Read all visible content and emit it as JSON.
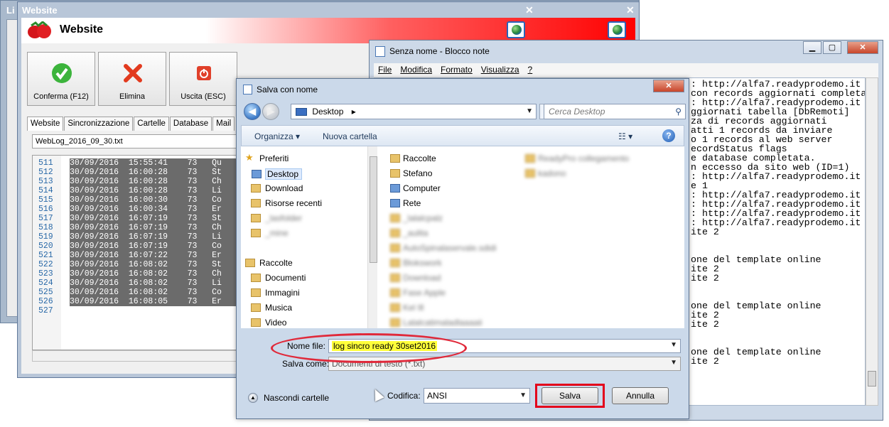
{
  "back_window": {
    "title": "Li"
  },
  "website_window": {
    "title": "Website",
    "header_title": "Website",
    "toolbar": [
      {
        "label": "Conferma (F12)",
        "icon": "check-icon"
      },
      {
        "label": "Elimina",
        "icon": "delete-x-icon"
      },
      {
        "label": "Uscita (ESC)",
        "icon": "power-icon"
      }
    ],
    "tabs": [
      "Website",
      "Sincronizzazione",
      "Cartelle",
      "Database",
      "Mail"
    ],
    "log_file": "WebLog_2016_09_30.txt",
    "log_rows": [
      {
        "ln": "511",
        "text": "30/09/2016  15:55:41    73   Qu"
      },
      {
        "ln": "512",
        "text": "30/09/2016  16:00:28    73   St"
      },
      {
        "ln": "513",
        "text": "30/09/2016  16:00:28    73   Ch"
      },
      {
        "ln": "514",
        "text": "30/09/2016  16:00:28    73   Li"
      },
      {
        "ln": "515",
        "text": "30/09/2016  16:00:30    73   Co"
      },
      {
        "ln": "516",
        "text": "30/09/2016  16:00:34    73   Er"
      },
      {
        "ln": "517",
        "text": "30/09/2016  16:07:19    73   St"
      },
      {
        "ln": "518",
        "text": "30/09/2016  16:07:19    73   Ch"
      },
      {
        "ln": "519",
        "text": "30/09/2016  16:07:19    73   Li"
      },
      {
        "ln": "520",
        "text": "30/09/2016  16:07:19    73   Co"
      },
      {
        "ln": "521",
        "text": "30/09/2016  16:07:22    73   Er"
      },
      {
        "ln": "522",
        "text": "30/09/2016  16:08:02    73   St"
      },
      {
        "ln": "523",
        "text": "30/09/2016  16:08:02    73   Ch"
      },
      {
        "ln": "524",
        "text": "30/09/2016  16:08:02    73   Li"
      },
      {
        "ln": "525",
        "text": "30/09/2016  16:08:02    73   Co"
      },
      {
        "ln": "526",
        "text": "30/09/2016  16:08:05    73   Er"
      },
      {
        "ln": "527",
        "text": ""
      }
    ]
  },
  "notepad": {
    "title": "Senza nome - Blocco note",
    "menu": [
      "File",
      "Modifica",
      "Formato",
      "Visualizza",
      "?"
    ],
    "lines": [
      ": http://alfa7.readyprodemo.it",
      "con records aggiornati completa",
      ": http://alfa7.readyprodemo.it",
      "ggiornati tabella [DbRemoti]",
      "za di records aggiornati",
      "atti 1 records da inviare",
      "o 1 records al web server",
      "ecordStatus flags",
      "e database completata.",
      "n eccesso da sito web (ID=1)",
      ": http://alfa7.readyprodemo.it",
      "e 1",
      ": http://alfa7.readyprodemo.it",
      ": http://alfa7.readyprodemo.it",
      ": http://alfa7.readyprodemo.it",
      ": http://alfa7.readyprodemo.it",
      "ite 2",
      "",
      "",
      "one del template online",
      "ite 2",
      "ite 2",
      "",
      "",
      "one del template online",
      "ite 2",
      "ite 2",
      "",
      "",
      "one del template online",
      "ite 2"
    ]
  },
  "save_dialog": {
    "title": "Salva con nome",
    "address": "Desktop",
    "search_placeholder": "Cerca Desktop",
    "organize_label": "Organizza",
    "new_folder_label": "Nuova cartella",
    "nav_items": [
      {
        "label": "Preferiti",
        "icon": "star-icon",
        "kind": "header",
        "blurred": false
      },
      {
        "label": "Desktop",
        "icon": "desktop-icon",
        "kind": "item",
        "blurred": false
      },
      {
        "label": "Download",
        "icon": "download-folder-icon",
        "kind": "item",
        "blurred": false
      },
      {
        "label": "Risorse recenti",
        "icon": "recent-places-icon",
        "kind": "item",
        "blurred": false
      },
      {
        "label": "_lasfolder",
        "icon": "folder-icon",
        "kind": "item",
        "blurred": true
      },
      {
        "label": "_mine",
        "icon": "folder-icon",
        "kind": "item",
        "blurred": true
      },
      {
        "label": "Raccolte",
        "icon": "libraries-icon",
        "kind": "header",
        "blurred": false
      },
      {
        "label": "Documenti",
        "icon": "documents-icon",
        "kind": "item",
        "blurred": false
      },
      {
        "label": "Immagini",
        "icon": "pictures-icon",
        "kind": "item",
        "blurred": false
      },
      {
        "label": "Musica",
        "icon": "music-icon",
        "kind": "item",
        "blurred": false
      },
      {
        "label": "Video",
        "icon": "video-icon",
        "kind": "item",
        "blurred": false
      }
    ],
    "files_col1": [
      {
        "label": "Raccolte",
        "icon": "libraries-icon",
        "blurred": false
      },
      {
        "label": "Stefano",
        "icon": "user-folder-icon",
        "blurred": false
      },
      {
        "label": "Computer",
        "icon": "computer-icon",
        "blurred": false
      },
      {
        "label": "Rete",
        "icon": "network-icon",
        "blurred": false
      },
      {
        "label": "_lalalcpalz",
        "icon": "folder-icon",
        "blurred": true
      },
      {
        "label": "_aulita",
        "icon": "folder-icon",
        "blurred": true
      },
      {
        "label": "AutoSpinalaservale.sdidi",
        "icon": "folder-icon",
        "blurred": true
      },
      {
        "label": "Blokswork",
        "icon": "folder-icon",
        "blurred": true
      },
      {
        "label": "Download",
        "icon": "folder-icon",
        "blurred": true
      },
      {
        "label": "Fase Apple",
        "icon": "folder-icon",
        "blurred": true
      },
      {
        "label": "Kel Ill",
        "icon": "folder-icon",
        "blurred": true
      },
      {
        "label": "Lalalcatimaladlaaaaii",
        "icon": "folder-icon",
        "blurred": true
      }
    ],
    "files_col2": [
      {
        "label": "ReadyPro collegamento",
        "icon": "folder-icon",
        "blurred": true
      },
      {
        "label": "kadono",
        "icon": "folder-icon",
        "blurred": true
      }
    ],
    "file_name_label": "Nome file:",
    "file_name_value": "log sincro ready 30set2016",
    "save_as_label": "Salva come:",
    "save_as_value": "Documenti di testo (*.txt)",
    "hide_folders_label": "Nascondi cartelle",
    "encoding_label": "Codifica:",
    "encoding_value": "ANSI",
    "save_button": "Salva",
    "cancel_button": "Annulla"
  },
  "colors": {
    "annotation_red": "#e3001b",
    "highlight_yellow": "#ffff3a"
  }
}
